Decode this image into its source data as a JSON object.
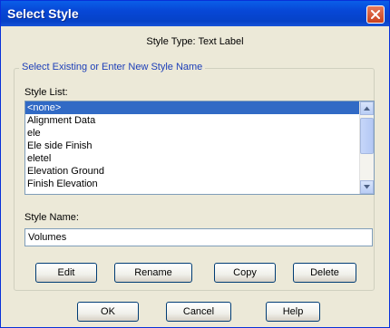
{
  "window": {
    "title": "Select Style"
  },
  "style_type": "Style Type: Text Label",
  "group": {
    "legend": "Select Existing or Enter New Style Name",
    "list_label": "Style List:",
    "list_items": [
      {
        "label": "<none>",
        "selected": true
      },
      {
        "label": "Alignment Data",
        "selected": false
      },
      {
        "label": "ele",
        "selected": false
      },
      {
        "label": "Ele side Finish",
        "selected": false
      },
      {
        "label": "eletel",
        "selected": false
      },
      {
        "label": "Elevation Ground",
        "selected": false
      },
      {
        "label": "Finish Elevation",
        "selected": false
      }
    ],
    "name_label": "Style Name:",
    "name_value": "Volumes"
  },
  "actions": {
    "edit": "Edit",
    "rename": "Rename",
    "copy": "Copy",
    "delete": "Delete"
  },
  "footer": {
    "ok": "OK",
    "cancel": "Cancel",
    "help": "Help"
  },
  "colors": {
    "title_bar": "#0747d6",
    "selection": "#316ac5",
    "legend_text": "#1d3fb8",
    "close_button": "#c9401d",
    "dialog_bg": "#ece9d8"
  },
  "icons": {
    "close": "close-icon",
    "scroll_up": "arrow-up-icon",
    "scroll_down": "arrow-down-icon"
  }
}
